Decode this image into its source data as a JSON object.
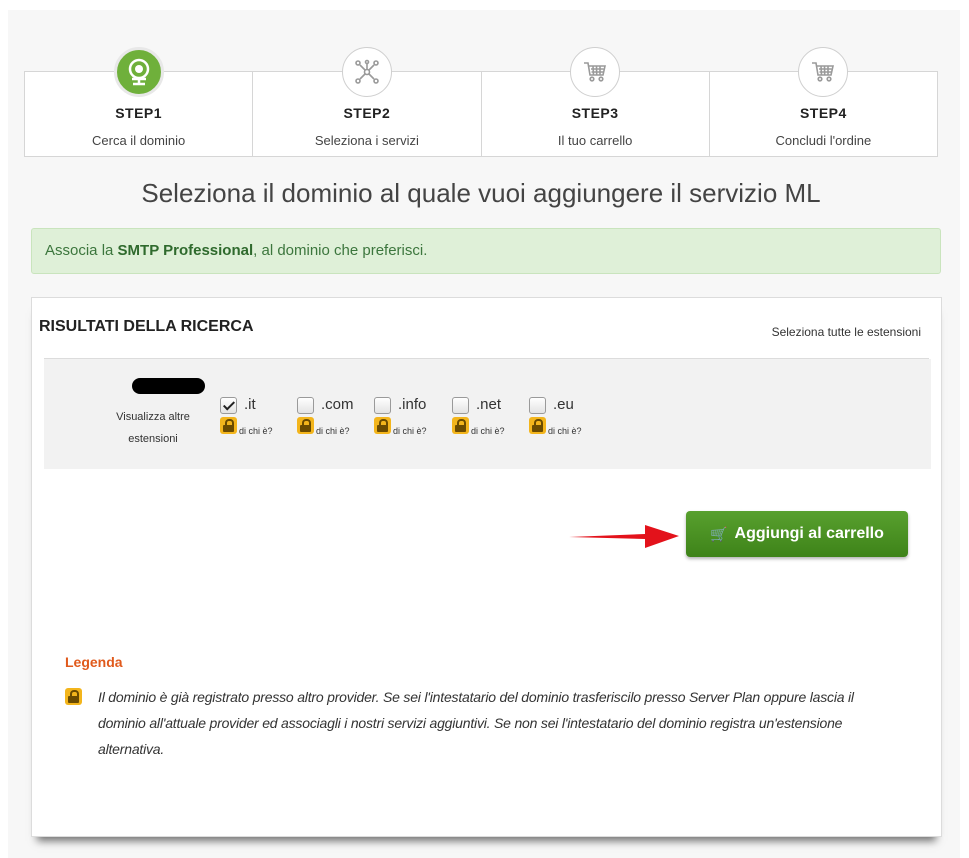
{
  "steps": [
    {
      "title": "STEP1",
      "subtitle": "Cerca il dominio",
      "icon": "globe-icon",
      "active": true
    },
    {
      "title": "STEP2",
      "subtitle": "Seleziona i servizi",
      "icon": "network-icon",
      "active": false
    },
    {
      "title": "STEP3",
      "subtitle": "Il tuo carrello",
      "icon": "cart-icon",
      "active": false
    },
    {
      "title": "STEP4",
      "subtitle": "Concludi l'ordine",
      "icon": "cart-icon",
      "active": false
    }
  ],
  "heading": "Seleziona il dominio al quale vuoi aggiungere il servizio ML",
  "alert": {
    "prefix": "Associa la ",
    "product": "SMTP Professional",
    "suffix": ", al dominio che preferisci."
  },
  "results": {
    "title": "RISULTATI DELLA RICERCA",
    "select_all": "Seleziona tutte le estensioni",
    "more_extensions": "Visualizza altre estensioni",
    "whois_label": "di chi è?",
    "extensions": [
      {
        "label": ".it",
        "checked": true
      },
      {
        "label": ".com",
        "checked": false
      },
      {
        "label": ".info",
        "checked": false
      },
      {
        "label": ".net",
        "checked": false
      },
      {
        "label": ".eu",
        "checked": false
      }
    ]
  },
  "add_to_cart": "Aggiungi al carrello",
  "legend": {
    "title": "Legenda",
    "text": "Il dominio è già registrato presso altro provider. Se sei l'intestatario del dominio trasferiscilo presso Server Plan oppure lascia il dominio all'attuale provider ed associagli i nostri servizi aggiuntivi. Se non sei l'intestatario del dominio registra un'estensione alternativa."
  },
  "colors": {
    "primary_green": "#4a9424",
    "active_step": "#6fb03b",
    "alert_bg": "#dff0d8",
    "legend_accent": "#e05a1c",
    "arrow": "#e3121b"
  }
}
